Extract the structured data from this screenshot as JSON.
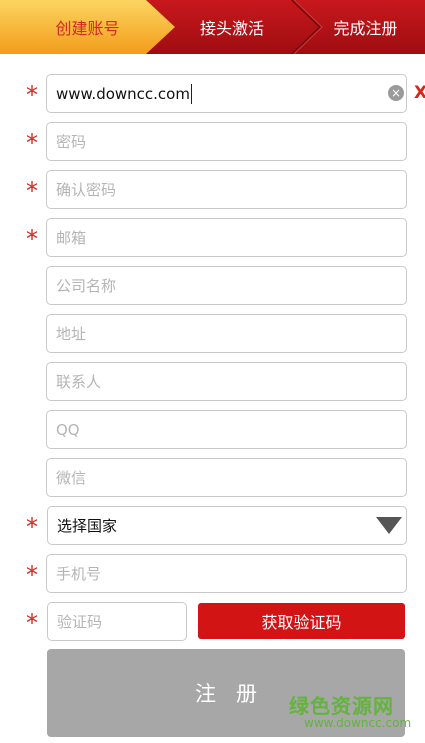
{
  "steps": {
    "step1": "创建账号",
    "step2": "接头激活",
    "step3": "完成注册"
  },
  "form": {
    "username_value": "www.downcc.com",
    "password_placeholder": "密码",
    "confirm_password_placeholder": "确认密码",
    "email_placeholder": "邮箱",
    "company_placeholder": "公司名称",
    "address_placeholder": "地址",
    "contact_placeholder": "联系人",
    "qq_placeholder": "QQ",
    "wechat_placeholder": "微信",
    "country_select": "选择国家",
    "phone_placeholder": "手机号",
    "code_placeholder": "验证码",
    "get_code_label": "获取验证码",
    "submit_label": "注册"
  },
  "required_mark": "*",
  "clear_glyph": "×",
  "error_glyph": "X",
  "watermark": {
    "main": "绿色资源网",
    "sub": "www.downcc.com"
  },
  "colors": {
    "stepbar": "#b31015",
    "accent_red": "#d4281f",
    "active_step": "#f5a623",
    "button_red": "#d21414",
    "submit_gray": "#a7a7a7",
    "watermark_green": "#5cb532"
  }
}
